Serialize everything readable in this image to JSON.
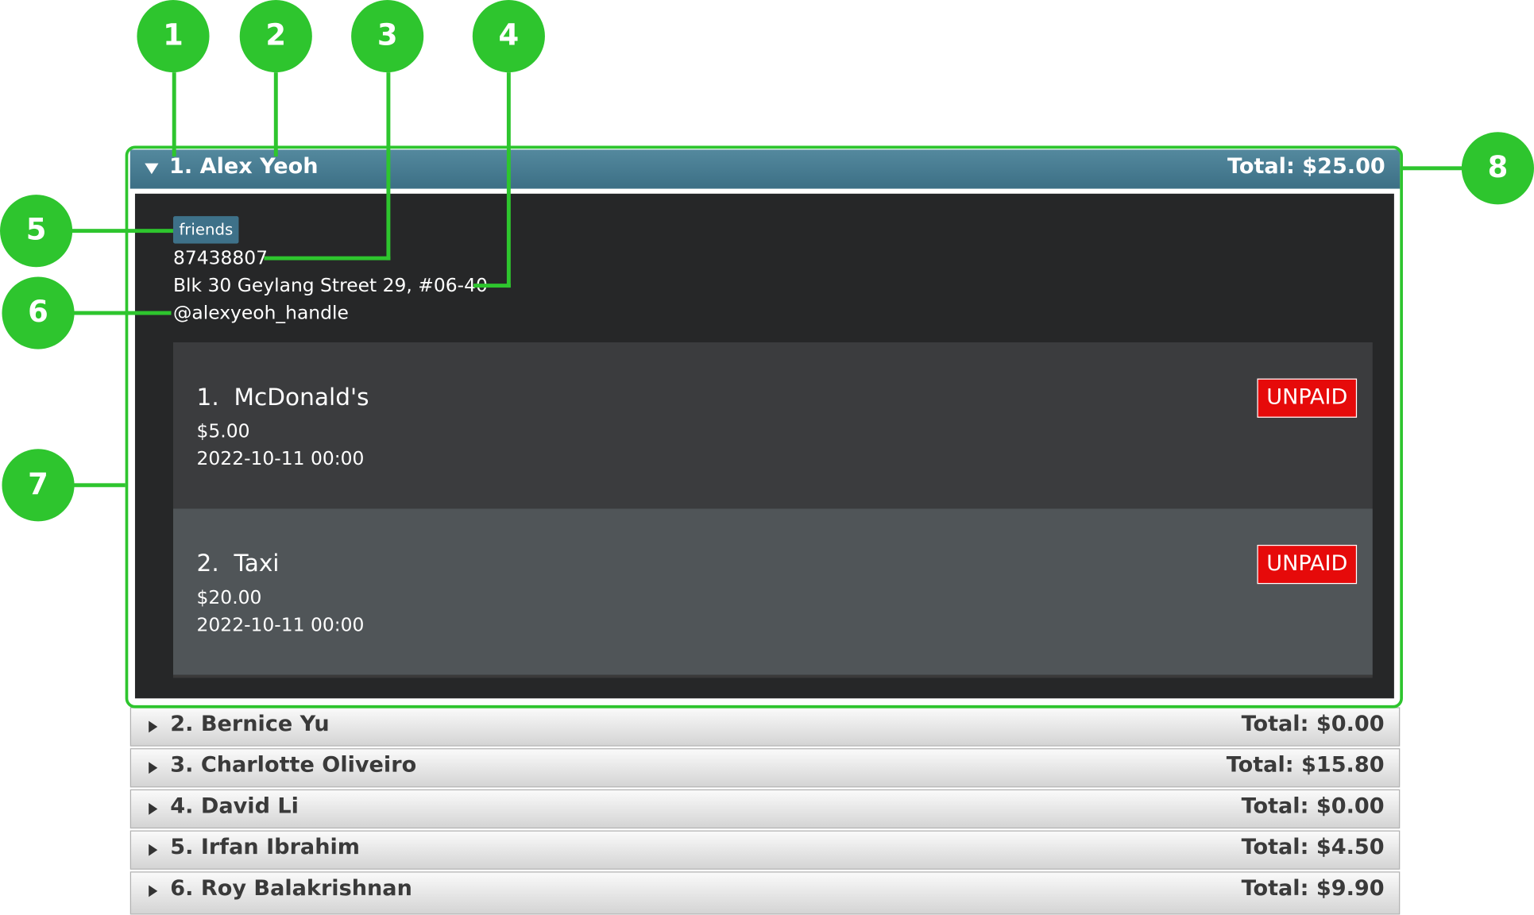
{
  "card": {
    "name": "1. Alex Yeoh",
    "total": "Total: $25.00",
    "tag": "friends",
    "phone": "87438807",
    "address": "Blk 30 Geylang Street 29, #06-40",
    "handle": "@alexyeoh_handle",
    "expenses": [
      {
        "index": "1.",
        "title": "McDonald's",
        "amount": "$5.00",
        "date": "2022-10-11 00:00",
        "status": "UNPAID"
      },
      {
        "index": "2.",
        "title": "Taxi",
        "amount": "$20.00",
        "date": "2022-10-11 00:00",
        "status": "UNPAID"
      }
    ]
  },
  "rows": [
    {
      "name": "2. Bernice Yu",
      "total": "Total: $0.00"
    },
    {
      "name": "3. Charlotte Oliveiro",
      "total": "Total: $15.80"
    },
    {
      "name": "4. David Li",
      "total": "Total: $0.00"
    },
    {
      "name": "5. Irfan Ibrahim",
      "total": "Total: $4.50"
    },
    {
      "name": "6. Roy Balakrishnan",
      "total": "Total: $9.90"
    }
  ],
  "callouts": [
    "1",
    "2",
    "3",
    "4",
    "5",
    "6",
    "7",
    "8"
  ],
  "colors": {
    "accent": "#2ec52e",
    "header": "#3c6f85",
    "unpaid": "#e60a0a",
    "card_bg": "#262728"
  }
}
